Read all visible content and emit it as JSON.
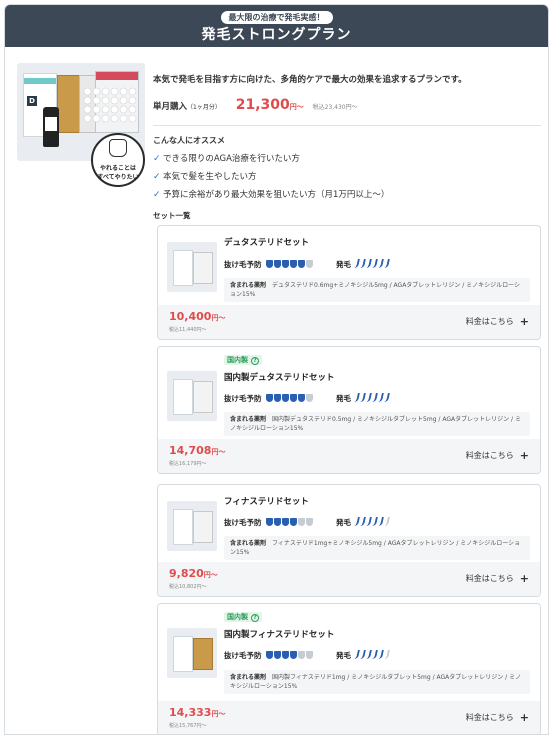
{
  "header": {
    "badge": "最大限の治療で発毛実感！",
    "title": "発毛ストロングプラン"
  },
  "hero": {
    "badge_line1": "やれることは",
    "badge_line2": "すべてやりたい"
  },
  "intro": "本気で発毛を目指す方に向けた、多角的ケアで最大の効果を追求するプランです。",
  "monthly": {
    "label": "単月購入",
    "period": "（1ヶ月分）",
    "price": "21,300",
    "yen": "円〜",
    "tax": "税込23,430円〜"
  },
  "recommend": {
    "heading": "こんな人にオススメ",
    "items": [
      "できる限りのAGA治療を行いたい方",
      "本気で髪を生やしたい方",
      "予算に余裕があり最大効果を狙いたい方（月1万円以上〜）"
    ]
  },
  "set_heading": "セット一覧",
  "labels": {
    "hair_loss": "抜け毛予防",
    "growth": "発毛",
    "ingredients": "含まれる薬剤",
    "more": "料金はこちら",
    "domestic": "国内製"
  },
  "sets": [
    {
      "name": "デュタステリドセット",
      "domestic": false,
      "prevention_level": 5,
      "growth_level": 6,
      "ingredients": "デュタステリド0.6mg+ミノキシジル5mg / AGAタブレットレリジン / ミノキシジルローション15%",
      "price": "10,400",
      "yen": "円〜",
      "tax": "税込11,440円〜"
    },
    {
      "name": "国内製デュタステリドセット",
      "domestic": true,
      "prevention_level": 5,
      "growth_level": 6,
      "ingredients": "国内製デュタステリド0.5mg / ミノキシジルタブレット5mg / AGAタブレットレリジン / ミノキシジルローション15%",
      "price": "14,708",
      "yen": "円〜",
      "tax": "税込16,179円〜"
    },
    {
      "name": "フィナステリドセット",
      "domestic": false,
      "prevention_level": 4,
      "growth_level": 5,
      "ingredients": "フィナステリド1mg+ミノキシジル5mg / AGAタブレットレリジン / ミノキシジルローション15%",
      "price": "9,820",
      "yen": "円〜",
      "tax": "税込10,802円〜"
    },
    {
      "name": "国内製フィナステリドセット",
      "domestic": true,
      "prevention_level": 4,
      "growth_level": 5,
      "ingredients": "国内製フィナステリド1mg / ミノキシジルタブレット5mg / AGAタブレットレリジン / ミノキシジルローション15%",
      "price": "14,333",
      "yen": "円〜",
      "tax": "税込15,767円〜"
    }
  ],
  "colors": {
    "header_bg": "#3c4856",
    "price_red": "#e04c4c",
    "accent_blue": "#2a5fb0",
    "domestic_green": "#2e9e5a"
  }
}
